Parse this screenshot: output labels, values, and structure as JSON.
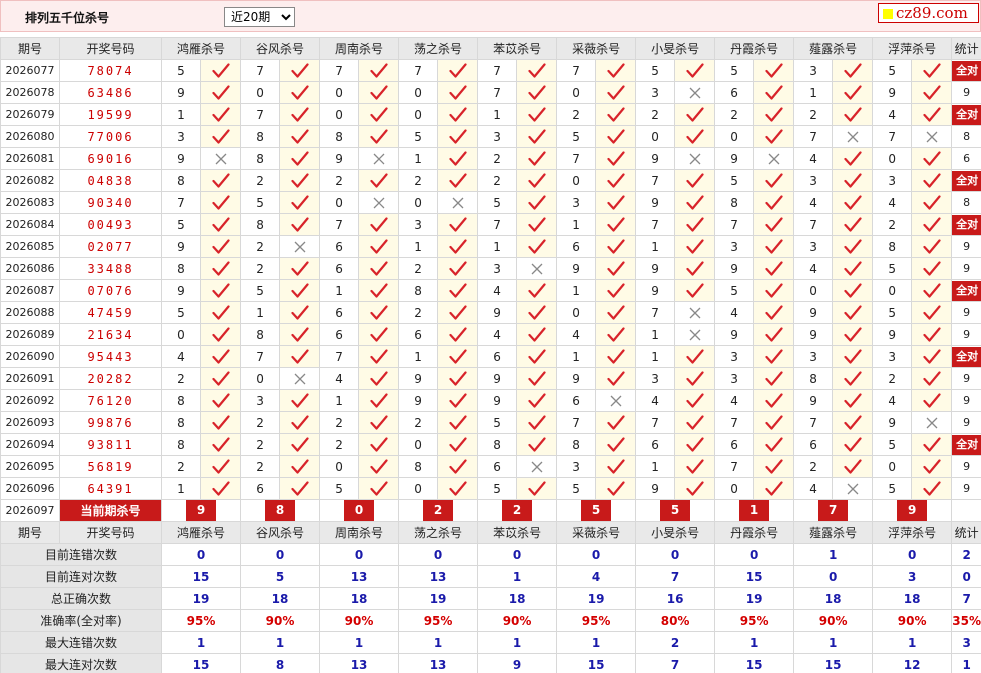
{
  "header": {
    "title": "排列五千位杀号",
    "period_selected": "近20期",
    "logo_text": "cz89.com"
  },
  "columns": {
    "period": "期号",
    "draw": "开奖号码",
    "methods": [
      "鸿雁杀号",
      "谷风杀号",
      "周南杀号",
      "荡之杀号",
      "苯苡杀号",
      "采薇杀号",
      "小旻杀号",
      "丹霞杀号",
      "薤露杀号",
      "浮萍杀号"
    ],
    "stats": "统计"
  },
  "rows": [
    {
      "period": "2026077",
      "draw": "78074",
      "kills": [
        5,
        7,
        7,
        7,
        7,
        7,
        5,
        5,
        3,
        5
      ],
      "ok": [
        1,
        1,
        1,
        1,
        1,
        1,
        1,
        1,
        1,
        1
      ],
      "stat": "全对"
    },
    {
      "period": "2026078",
      "draw": "63486",
      "kills": [
        9,
        0,
        0,
        0,
        7,
        0,
        3,
        6,
        1,
        9
      ],
      "ok": [
        1,
        1,
        1,
        1,
        1,
        1,
        0,
        1,
        1,
        1
      ],
      "stat": "9"
    },
    {
      "period": "2026079",
      "draw": "19599",
      "kills": [
        1,
        7,
        0,
        0,
        1,
        2,
        2,
        2,
        2,
        4
      ],
      "ok": [
        1,
        1,
        1,
        1,
        1,
        1,
        1,
        1,
        1,
        1
      ],
      "stat": "全对"
    },
    {
      "period": "2026080",
      "draw": "77006",
      "kills": [
        3,
        8,
        8,
        5,
        3,
        5,
        0,
        0,
        7,
        7
      ],
      "ok": [
        1,
        1,
        1,
        1,
        1,
        1,
        1,
        1,
        0,
        0
      ],
      "stat": "8"
    },
    {
      "period": "2026081",
      "draw": "69016",
      "kills": [
        9,
        8,
        9,
        1,
        2,
        7,
        9,
        9,
        4,
        0
      ],
      "ok": [
        0,
        1,
        0,
        1,
        1,
        1,
        0,
        0,
        1,
        1
      ],
      "stat": "6"
    },
    {
      "period": "2026082",
      "draw": "04838",
      "kills": [
        8,
        2,
        2,
        2,
        2,
        0,
        7,
        5,
        3,
        3
      ],
      "ok": [
        1,
        1,
        1,
        1,
        1,
        1,
        1,
        1,
        1,
        1
      ],
      "stat": "全对"
    },
    {
      "period": "2026083",
      "draw": "90340",
      "kills": [
        7,
        5,
        0,
        0,
        5,
        3,
        9,
        8,
        4,
        4
      ],
      "ok": [
        1,
        1,
        0,
        0,
        1,
        1,
        1,
        1,
        1,
        1
      ],
      "stat": "8"
    },
    {
      "period": "2026084",
      "draw": "00493",
      "kills": [
        5,
        8,
        7,
        3,
        7,
        1,
        7,
        7,
        7,
        2
      ],
      "ok": [
        1,
        1,
        1,
        1,
        1,
        1,
        1,
        1,
        1,
        1
      ],
      "stat": "全对"
    },
    {
      "period": "2026085",
      "draw": "02077",
      "kills": [
        9,
        2,
        6,
        1,
        1,
        6,
        1,
        3,
        3,
        8
      ],
      "ok": [
        1,
        0,
        1,
        1,
        1,
        1,
        1,
        1,
        1,
        1
      ],
      "stat": "9"
    },
    {
      "period": "2026086",
      "draw": "33488",
      "kills": [
        8,
        2,
        6,
        2,
        3,
        9,
        9,
        9,
        4,
        5
      ],
      "ok": [
        1,
        1,
        1,
        1,
        0,
        1,
        1,
        1,
        1,
        1
      ],
      "stat": "9"
    },
    {
      "period": "2026087",
      "draw": "07076",
      "kills": [
        9,
        5,
        1,
        8,
        4,
        1,
        9,
        5,
        0,
        0
      ],
      "ok": [
        1,
        1,
        1,
        1,
        1,
        1,
        1,
        1,
        1,
        1
      ],
      "stat": "全对"
    },
    {
      "period": "2026088",
      "draw": "47459",
      "kills": [
        5,
        1,
        6,
        2,
        9,
        0,
        7,
        4,
        9,
        5
      ],
      "ok": [
        1,
        1,
        1,
        1,
        1,
        1,
        0,
        1,
        1,
        1
      ],
      "stat": "9"
    },
    {
      "period": "2026089",
      "draw": "21634",
      "kills": [
        0,
        8,
        6,
        6,
        4,
        4,
        1,
        9,
        9,
        9
      ],
      "ok": [
        1,
        1,
        1,
        1,
        1,
        1,
        0,
        1,
        1,
        1
      ],
      "stat": "9"
    },
    {
      "period": "2026090",
      "draw": "95443",
      "kills": [
        4,
        7,
        7,
        1,
        6,
        1,
        1,
        3,
        3,
        3
      ],
      "ok": [
        1,
        1,
        1,
        1,
        1,
        1,
        1,
        1,
        1,
        1
      ],
      "stat": "全对"
    },
    {
      "period": "2026091",
      "draw": "20282",
      "kills": [
        2,
        0,
        4,
        9,
        9,
        9,
        3,
        3,
        8,
        2
      ],
      "ok": [
        1,
        0,
        1,
        1,
        1,
        1,
        1,
        1,
        1,
        1
      ],
      "stat": "9"
    },
    {
      "period": "2026092",
      "draw": "76120",
      "kills": [
        8,
        3,
        1,
        9,
        9,
        6,
        4,
        4,
        9,
        4
      ],
      "ok": [
        1,
        1,
        1,
        1,
        1,
        0,
        1,
        1,
        1,
        1
      ],
      "stat": "9"
    },
    {
      "period": "2026093",
      "draw": "99876",
      "kills": [
        8,
        2,
        2,
        2,
        5,
        7,
        7,
        7,
        7,
        9
      ],
      "ok": [
        1,
        1,
        1,
        1,
        1,
        1,
        1,
        1,
        1,
        0
      ],
      "stat": "9"
    },
    {
      "period": "2026094",
      "draw": "93811",
      "kills": [
        8,
        2,
        2,
        0,
        8,
        8,
        6,
        6,
        6,
        5
      ],
      "ok": [
        1,
        1,
        1,
        1,
        1,
        1,
        1,
        1,
        1,
        1
      ],
      "stat": "全对"
    },
    {
      "period": "2026095",
      "draw": "56819",
      "kills": [
        2,
        2,
        0,
        8,
        6,
        3,
        1,
        7,
        2,
        0
      ],
      "ok": [
        1,
        1,
        1,
        1,
        0,
        1,
        1,
        1,
        1,
        1
      ],
      "stat": "9"
    },
    {
      "period": "2026096",
      "draw": "64391",
      "kills": [
        1,
        6,
        5,
        0,
        5,
        5,
        9,
        0,
        4,
        5
      ],
      "ok": [
        1,
        1,
        1,
        1,
        1,
        1,
        1,
        1,
        0,
        1
      ],
      "stat": "9"
    }
  ],
  "current": {
    "period": "2026097",
    "label": "当前期杀号",
    "kills": [
      "9",
      "8",
      "0",
      "2",
      "2",
      "5",
      "5",
      "1",
      "7",
      "9"
    ]
  },
  "stats": [
    {
      "label": "目前连错次数",
      "values": [
        "0",
        "0",
        "0",
        "0",
        "0",
        "0",
        "0",
        "0",
        "1",
        "0"
      ],
      "total": "2",
      "color": "blue"
    },
    {
      "label": "目前连对次数",
      "values": [
        "15",
        "5",
        "13",
        "13",
        "1",
        "4",
        "7",
        "15",
        "0",
        "3"
      ],
      "total": "0",
      "color": "blue"
    },
    {
      "label": "总正确次数",
      "values": [
        "19",
        "18",
        "18",
        "19",
        "18",
        "19",
        "16",
        "19",
        "18",
        "18"
      ],
      "total": "7",
      "color": "blue"
    },
    {
      "label": "准确率(全对率)",
      "values": [
        "95%",
        "90%",
        "90%",
        "95%",
        "90%",
        "95%",
        "80%",
        "95%",
        "90%",
        "90%"
      ],
      "total": "35%",
      "color": "red"
    },
    {
      "label": "最大连错次数",
      "values": [
        "1",
        "1",
        "1",
        "1",
        "1",
        "1",
        "2",
        "1",
        "1",
        "1"
      ],
      "total": "3",
      "color": "blue"
    },
    {
      "label": "最大连对次数",
      "values": [
        "15",
        "8",
        "13",
        "13",
        "9",
        "15",
        "7",
        "15",
        "15",
        "12"
      ],
      "total": "1",
      "color": "blue"
    }
  ],
  "colors": {
    "accent": "#c81a1a",
    "check": "#d8232a",
    "cross": "#888888",
    "stat_blue": "#1a1aaa",
    "stat_red": "#d40000"
  }
}
